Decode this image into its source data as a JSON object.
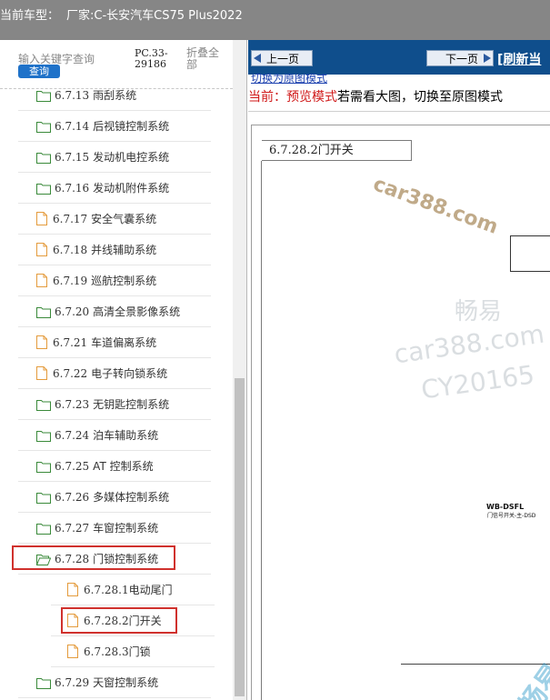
{
  "topbar": {
    "label": "当前车型：",
    "vehicle": "厂家:C-长安汽车CS75 Plus2022"
  },
  "left_panel": {
    "search_label": "输入关键字查询",
    "query_button": "查询",
    "pc_code": "PC.33-29186",
    "collapse_all": "折叠全部",
    "items": [
      {
        "num": "6.7.13",
        "label": "雨刮系统",
        "kind": "folder"
      },
      {
        "num": "6.7.14",
        "label": "后视镜控制系统",
        "kind": "folder"
      },
      {
        "num": "6.7.15",
        "label": "发动机电控系统",
        "kind": "folder"
      },
      {
        "num": "6.7.16",
        "label": "发动机附件系统",
        "kind": "folder"
      },
      {
        "num": "6.7.17",
        "label": "安全气囊系统",
        "kind": "file"
      },
      {
        "num": "6.7.18",
        "label": "并线辅助系统",
        "kind": "file"
      },
      {
        "num": "6.7.19",
        "label": "巡航控制系统",
        "kind": "file"
      },
      {
        "num": "6.7.20",
        "label": "高清全景影像系统",
        "kind": "folder"
      },
      {
        "num": "6.7.21",
        "label": "车道偏离系统",
        "kind": "file"
      },
      {
        "num": "6.7.22",
        "label": "电子转向锁系统",
        "kind": "file"
      },
      {
        "num": "6.7.23",
        "label": "无钥匙控制系统",
        "kind": "folder"
      },
      {
        "num": "6.7.24",
        "label": "泊车辅助系统",
        "kind": "folder"
      },
      {
        "num": "6.7.25",
        "label": "AT 控制系统",
        "kind": "folder"
      },
      {
        "num": "6.7.26",
        "label": "多媒体控制系统",
        "kind": "folder"
      },
      {
        "num": "6.7.27",
        "label": "车窗控制系统",
        "kind": "folder"
      },
      {
        "num": "6.7.28",
        "label": "门锁控制系统",
        "kind": "folder-open"
      },
      {
        "num": "6.7.28.1",
        "label": "电动尾门",
        "kind": "file"
      },
      {
        "num": "6.7.28.2",
        "label": "门开关",
        "kind": "file"
      },
      {
        "num": "6.7.28.3",
        "label": "门锁",
        "kind": "file"
      },
      {
        "num": "6.7.29",
        "label": "天窗控制系统",
        "kind": "folder"
      }
    ]
  },
  "right_panel": {
    "prev_button": "上一页",
    "next_button": "下一页",
    "refresh_link": "[刷新当",
    "switch_link": "切换为原图模式",
    "current_label": "当前：",
    "current_mode": "预览模式",
    "hint": "若需看大图，切换至原图模式"
  },
  "document": {
    "section_title": "6.7.28.2门开关",
    "connector_label": "WB-DSFL",
    "connector_sub": "门信号开关-主-DSD",
    "watermark_url": "car388.com",
    "watermark_cn": "畅易",
    "watermark_code": "CY20165",
    "watermark_corner": "畅易"
  },
  "colors": {
    "topbar_bg": "#868686",
    "navbar_bg": "#0f4e8c",
    "highlight_border": "#d0312d",
    "folder_green": "#3a8a3a",
    "file_orange": "#e49b3c",
    "current_mode_red": "#d01a1a"
  }
}
